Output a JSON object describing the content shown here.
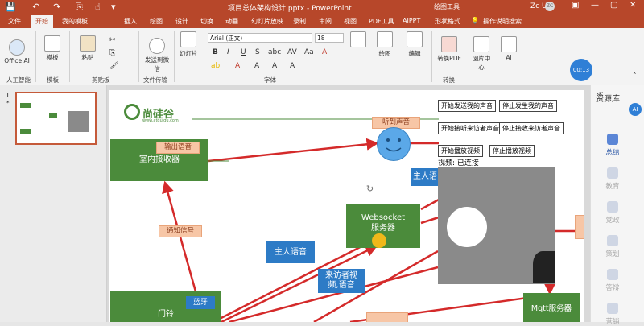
{
  "titlebar": {
    "title": "项目总体架构设计.pptx - PowerPoint",
    "context_tab": "绘图工具",
    "user": "Zc U",
    "avatar": "ZC",
    "accent": "#b7472a"
  },
  "tabs": [
    "文件",
    "开始",
    "我的模板",
    "插入",
    "绘图",
    "设计",
    "切换",
    "动画",
    "幻灯片放映",
    "录制",
    "审阅",
    "视图",
    "PDF工具",
    "AIPPT",
    "形状格式",
    "操作说明搜索"
  ],
  "active_tab": "开始",
  "ribbon": {
    "office_ai": "Office AI",
    "template": "模板",
    "paste": "粘贴",
    "send": "发送到微信",
    "new_slide": "幻灯片",
    "font_name": "Arial (正文)",
    "font_size": "18",
    "draw": "绘图",
    "edit": "编辑",
    "convert_pdf": "转换PDF",
    "ocr": "図片中心",
    "ai": "AI",
    "timer": "00:13",
    "groups": {
      "ai": "人工智能",
      "template": "模板",
      "clipboard": "剪贴板",
      "file_transfer": "文件传输",
      "font": "字体",
      "convert": "转换"
    }
  },
  "slides_panel": {
    "slide_number": "1"
  },
  "slide": {
    "logo_text": "尚硅谷",
    "logo_sub": "www.atguigu.com",
    "receiver": "室内接收器",
    "output_voice_label": "输出语音",
    "listen_voice_label": "听到声音",
    "websocket": "Websocket\n服务器",
    "host_voice_1": "主人语",
    "host_voice_2": "主人语音",
    "visitor_av": "来访者视\n频,语音",
    "notify_label": "通知信号",
    "doorbell": "门铃",
    "bluetooth": "蓝牙",
    "mqtt": "Mqtt服务器",
    "video_status": "视频: 已连接",
    "buttons": [
      [
        "开始发送我的声音",
        "停止发生我的声音"
      ],
      [
        "开始接听来访者声音",
        "停止接收来访者声音"
      ],
      [
        "开始播放视频",
        "停止播放视频"
      ]
    ]
  },
  "right_panel": {
    "title": "资源库",
    "items": [
      "总结",
      "教育",
      "党政",
      "策划",
      "答辩",
      "营销",
      "总结"
    ]
  }
}
